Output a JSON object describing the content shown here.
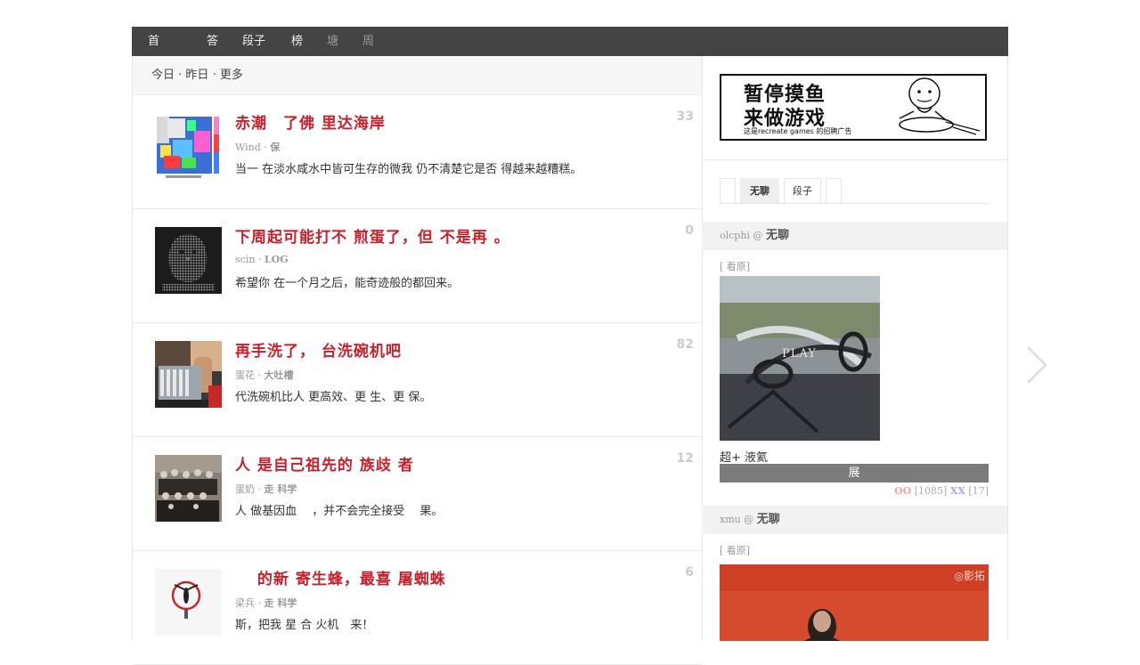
{
  "nav": {
    "items": [
      "首",
      "答",
      "段子",
      "榜",
      "塘",
      "周"
    ]
  },
  "subnav": {
    "today": "今日",
    "yesterday": "昨日",
    "more": "更多",
    "sep": " · "
  },
  "posts": [
    {
      "title": "赤潮　了佛 里达海岸",
      "author": "Wind",
      "tag": "保",
      "excerpt": "当一 在淡水咸水中皆可生存的微我 仍不清楚它是否 得越来越糟糕。",
      "count": "33"
    },
    {
      "title": "下周起可能打不 煎蛋了，但 不是再 。",
      "author": "scin",
      "tag": "LOG",
      "excerpt": "希望你 在一个月之后，能奇迹般的都回来。",
      "count": "0"
    },
    {
      "title": "再手洗了， 台洗碗机吧",
      "author": "蛋花",
      "tag": "大吐槽",
      "excerpt": "代洗碗机比人 更高效、更 生、更 保。",
      "count": "82"
    },
    {
      "title": "人 是自己祖先的 族歧 者",
      "author": "蛋奶",
      "tag": "走 科学",
      "excerpt": "人 做基因血　 ，并不会完全接受　 果。",
      "count": "12"
    },
    {
      "title": "　 的新 寄生蜂，最喜 屠蜘蛛",
      "author": "梁兵",
      "tag": "走 科学",
      "excerpt": "斯，把我 星 合 火机　来！",
      "count": "6"
    }
  ],
  "ad": {
    "line1": "暂停摸鱼",
    "line2": "来做游戏",
    "line3": "这是recreate games 的招聘广告"
  },
  "side_tabs": [
    "",
    "无聊",
    "段子",
    ""
  ],
  "side_posts": [
    {
      "user": "olcphi",
      "at": " @ ",
      "category": "无聊",
      "see_original": "[ 看原]",
      "play": "PLAY",
      "caption": "超+ 液氦",
      "expand": "展",
      "oo": "OO",
      "oo_count": "[1085]",
      "xx": "XX",
      "xx_count": "[17]"
    },
    {
      "user": "xmu",
      "at": " @ ",
      "category": "无聊",
      "see_original": "[ 看原]",
      "watermark": "◎影拓"
    }
  ],
  "colors": {
    "accent": "#c8202a",
    "nav_bg": "#444444",
    "oo": "#f4a1a1",
    "xx": "#a6a6f2"
  },
  "icons": {
    "next": "chevron-right-icon"
  }
}
